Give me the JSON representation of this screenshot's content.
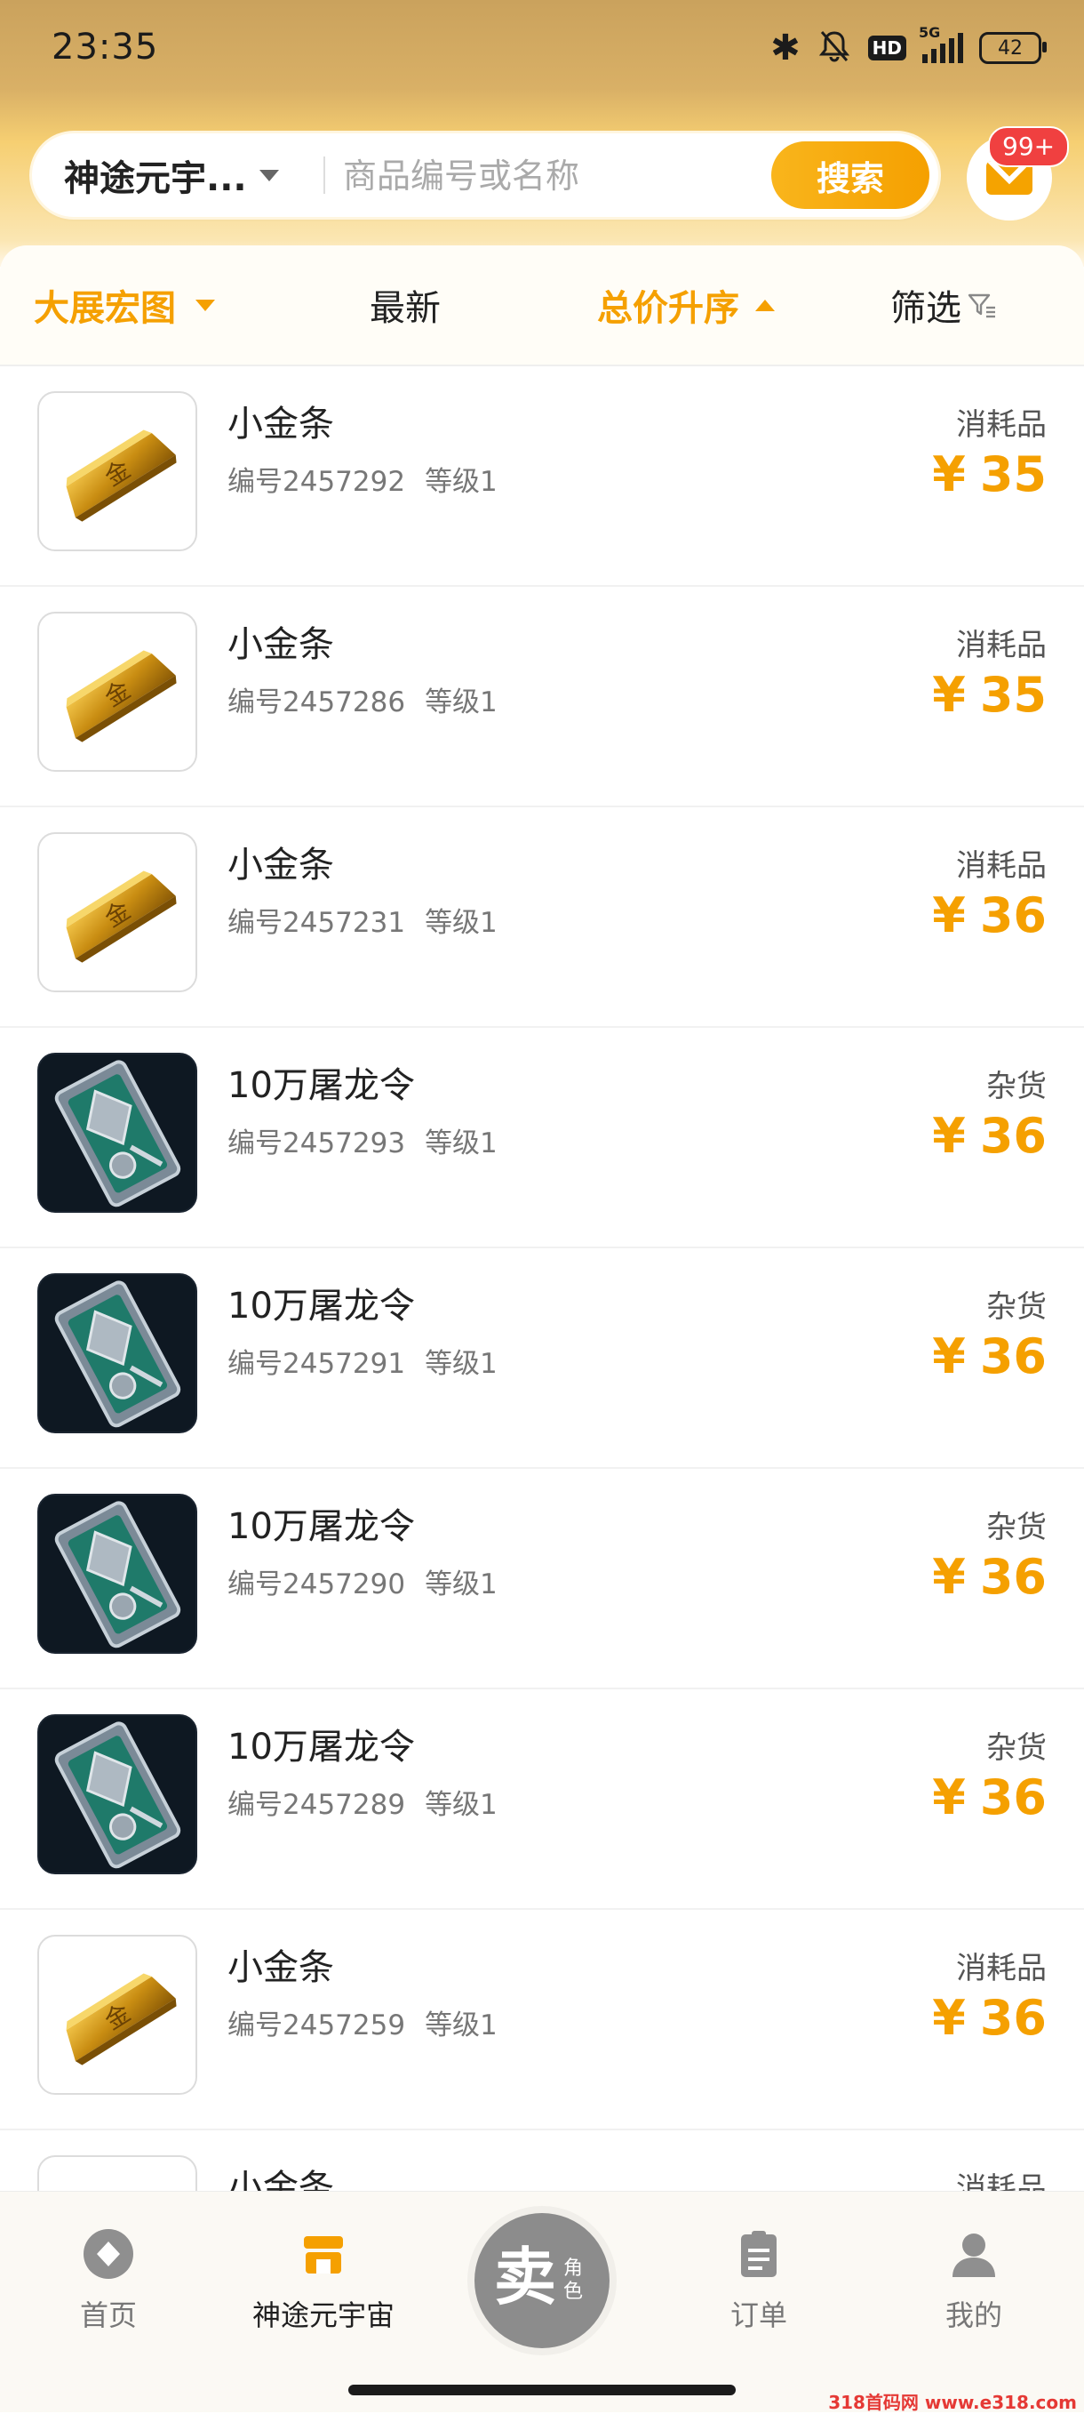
{
  "status_bar": {
    "time": "23:35",
    "network": "5G",
    "hd_label": "HD",
    "battery": "42"
  },
  "search": {
    "game_selector": "神途元宇...",
    "placeholder": "商品编号或名称",
    "button_label": "搜索",
    "mail_badge": "99+"
  },
  "filters": {
    "server": "大展宏图",
    "newest": "最新",
    "sort": "总价升序",
    "filter": "筛选"
  },
  "items": [
    {
      "name": "小金条",
      "code": "编号2457292",
      "level": "等级1",
      "category": "消耗品",
      "currency": "¥",
      "price": "35",
      "icon": "gold-bar-icon"
    },
    {
      "name": "小金条",
      "code": "编号2457286",
      "level": "等级1",
      "category": "消耗品",
      "currency": "¥",
      "price": "35",
      "icon": "gold-bar-icon"
    },
    {
      "name": "小金条",
      "code": "编号2457231",
      "level": "等级1",
      "category": "消耗品",
      "currency": "¥",
      "price": "36",
      "icon": "gold-bar-icon"
    },
    {
      "name": "10万屠龙令",
      "code": "编号2457293",
      "level": "等级1",
      "category": "杂货",
      "currency": "¥",
      "price": "36",
      "icon": "dragon-token-icon"
    },
    {
      "name": "10万屠龙令",
      "code": "编号2457291",
      "level": "等级1",
      "category": "杂货",
      "currency": "¥",
      "price": "36",
      "icon": "dragon-token-icon"
    },
    {
      "name": "10万屠龙令",
      "code": "编号2457290",
      "level": "等级1",
      "category": "杂货",
      "currency": "¥",
      "price": "36",
      "icon": "dragon-token-icon"
    },
    {
      "name": "10万屠龙令",
      "code": "编号2457289",
      "level": "等级1",
      "category": "杂货",
      "currency": "¥",
      "price": "36",
      "icon": "dragon-token-icon"
    },
    {
      "name": "小金条",
      "code": "编号2457259",
      "level": "等级1",
      "category": "消耗品",
      "currency": "¥",
      "price": "36",
      "icon": "gold-bar-icon"
    },
    {
      "name": "小金条",
      "code": "",
      "level": "",
      "category": "消耗品",
      "currency": "¥",
      "price": "",
      "icon": "gold-bar-icon"
    }
  ],
  "nav": {
    "home": "首页",
    "metaverse": "神途元宇宙",
    "sell_main": "卖",
    "sell_sub": "角色",
    "orders": "订单",
    "mine": "我的"
  },
  "watermark": "318首码网 www.e318.com",
  "colors": {
    "accent": "#f5a000",
    "badge": "#f04040",
    "header": "#f6cf72"
  }
}
